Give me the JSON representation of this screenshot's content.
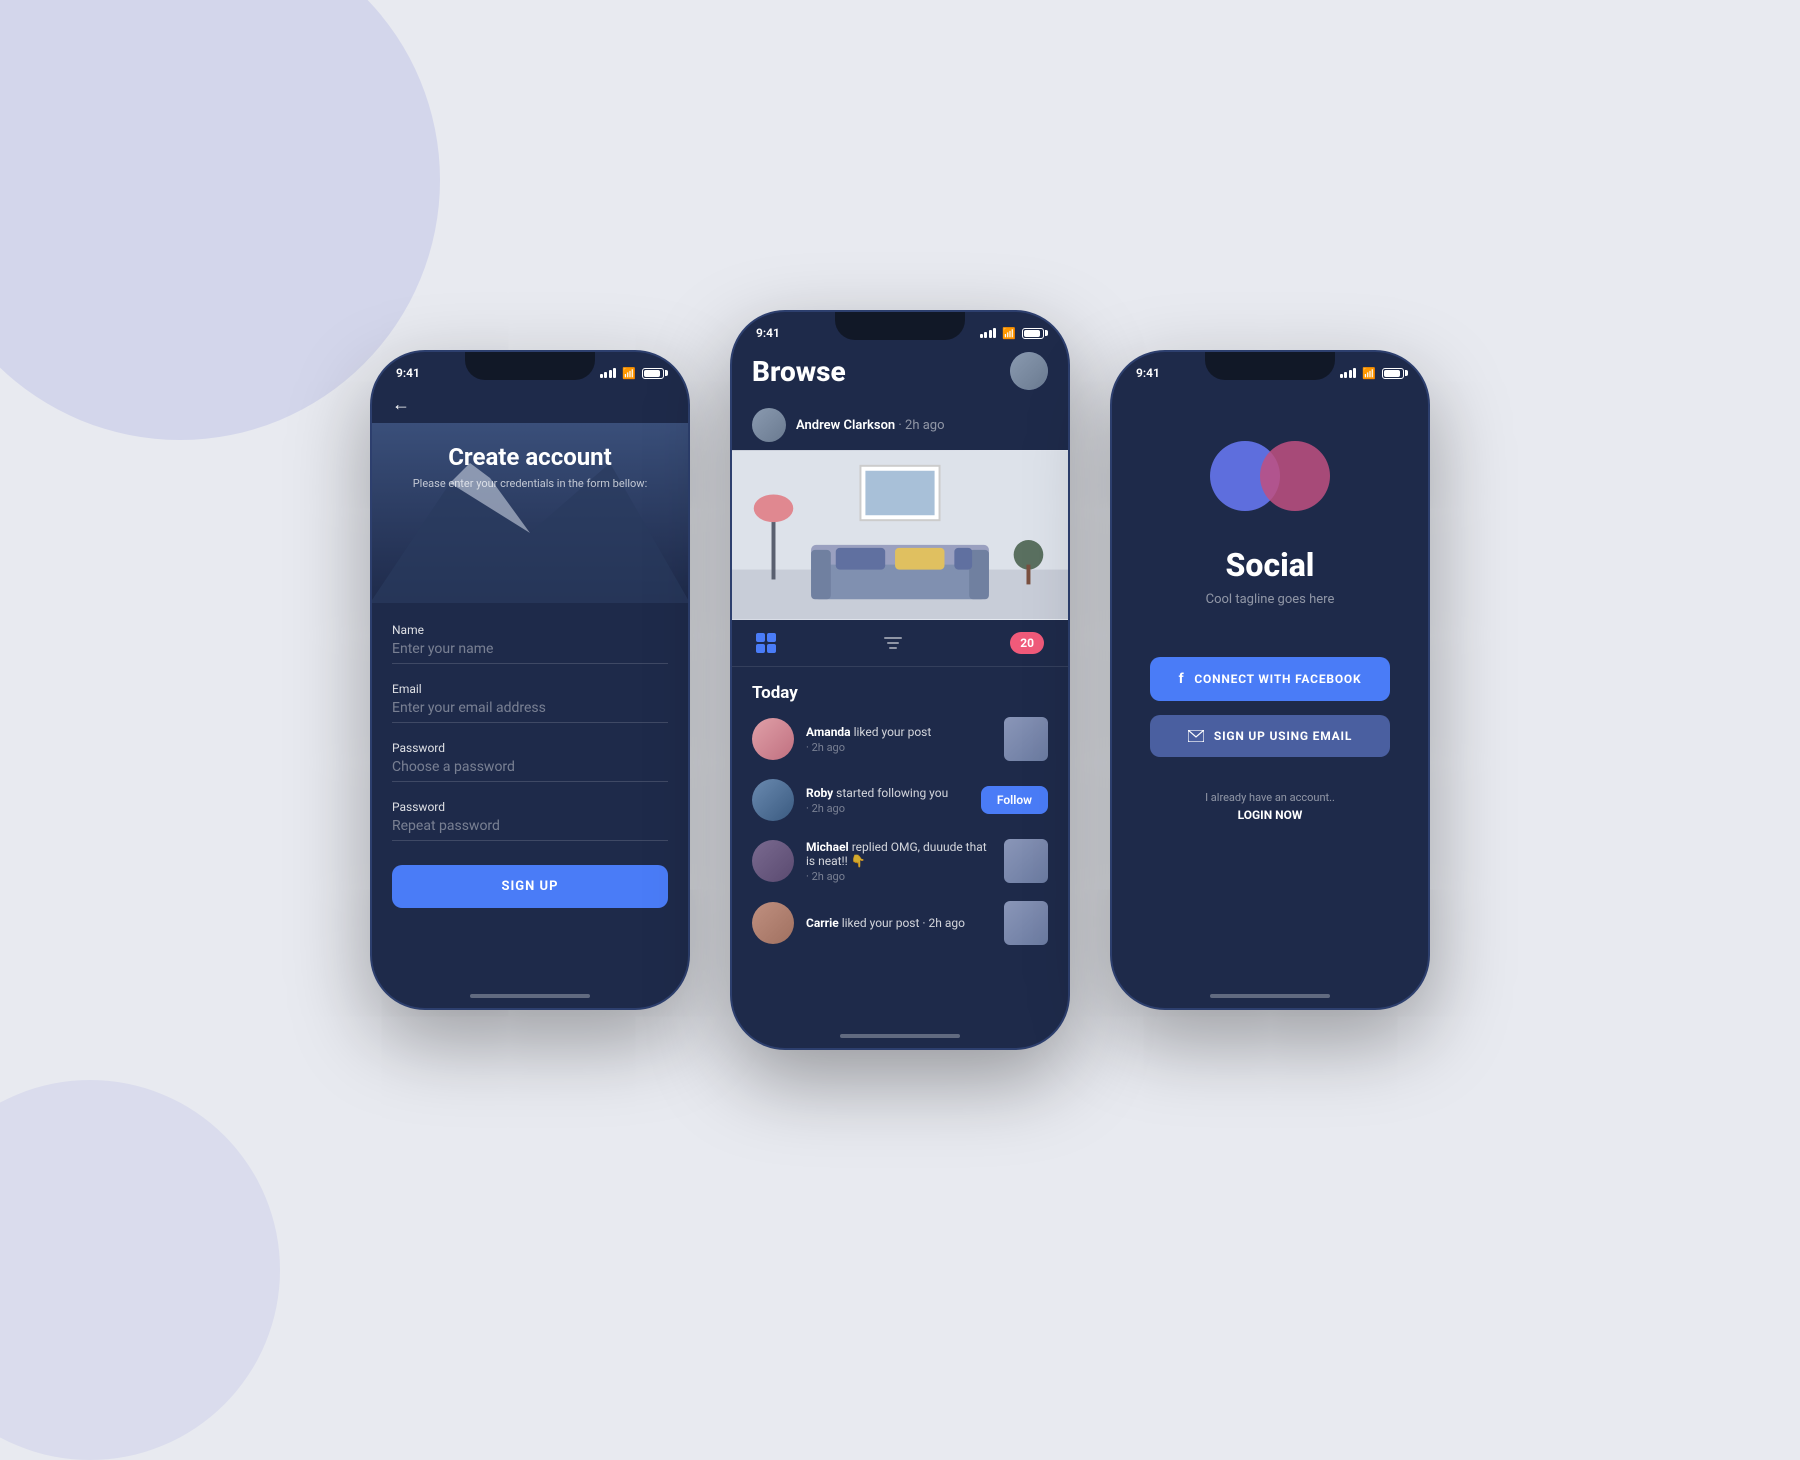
{
  "background": {
    "color": "#e8eaf0"
  },
  "phone_left": {
    "status_bar": {
      "time": "9:41"
    },
    "back_arrow": "←",
    "title": "Create account",
    "subtitle": "Please enter your credentials in the form bellow:",
    "form": {
      "name_label": "Name",
      "name_placeholder": "Enter your name",
      "email_label": "Email",
      "email_placeholder": "Enter your email address",
      "password_label": "Password",
      "password_placeholder": "Choose a password",
      "repeat_label": "Password",
      "repeat_placeholder": "Repeat password",
      "signup_button": "SIGN UP"
    }
  },
  "phone_center": {
    "status_bar": {
      "time": "9:41"
    },
    "browse_title": "Browse",
    "post": {
      "author": "Andrew Clarkson",
      "time": "2h ago"
    },
    "tabs": {
      "notification_count": "20"
    },
    "section_title": "Today",
    "activities": [
      {
        "name": "Amanda",
        "action": "liked your post",
        "time": "· 2h ago",
        "type": "thumb"
      },
      {
        "name": "Roby",
        "action": "started following you",
        "time": "· 2h ago",
        "type": "follow",
        "follow_label": "Follow"
      },
      {
        "name": "Michael",
        "action": "replied OMG, duuude that is neat!! 👇",
        "time": "· 2h ago",
        "type": "thumb"
      },
      {
        "name": "Carrie",
        "action": "liked your post ·",
        "time": "2h ago",
        "type": "thumb"
      }
    ]
  },
  "phone_right": {
    "status_bar": {
      "time": "9:41"
    },
    "app_title": "Social",
    "tagline": "Cool tagline goes here",
    "facebook_button": "CONNECT WITH FACEBOOK",
    "email_button": "SIGN UP USING EMAIL",
    "login_text": "I already have an account..",
    "login_link": "LOGIN NOW"
  }
}
